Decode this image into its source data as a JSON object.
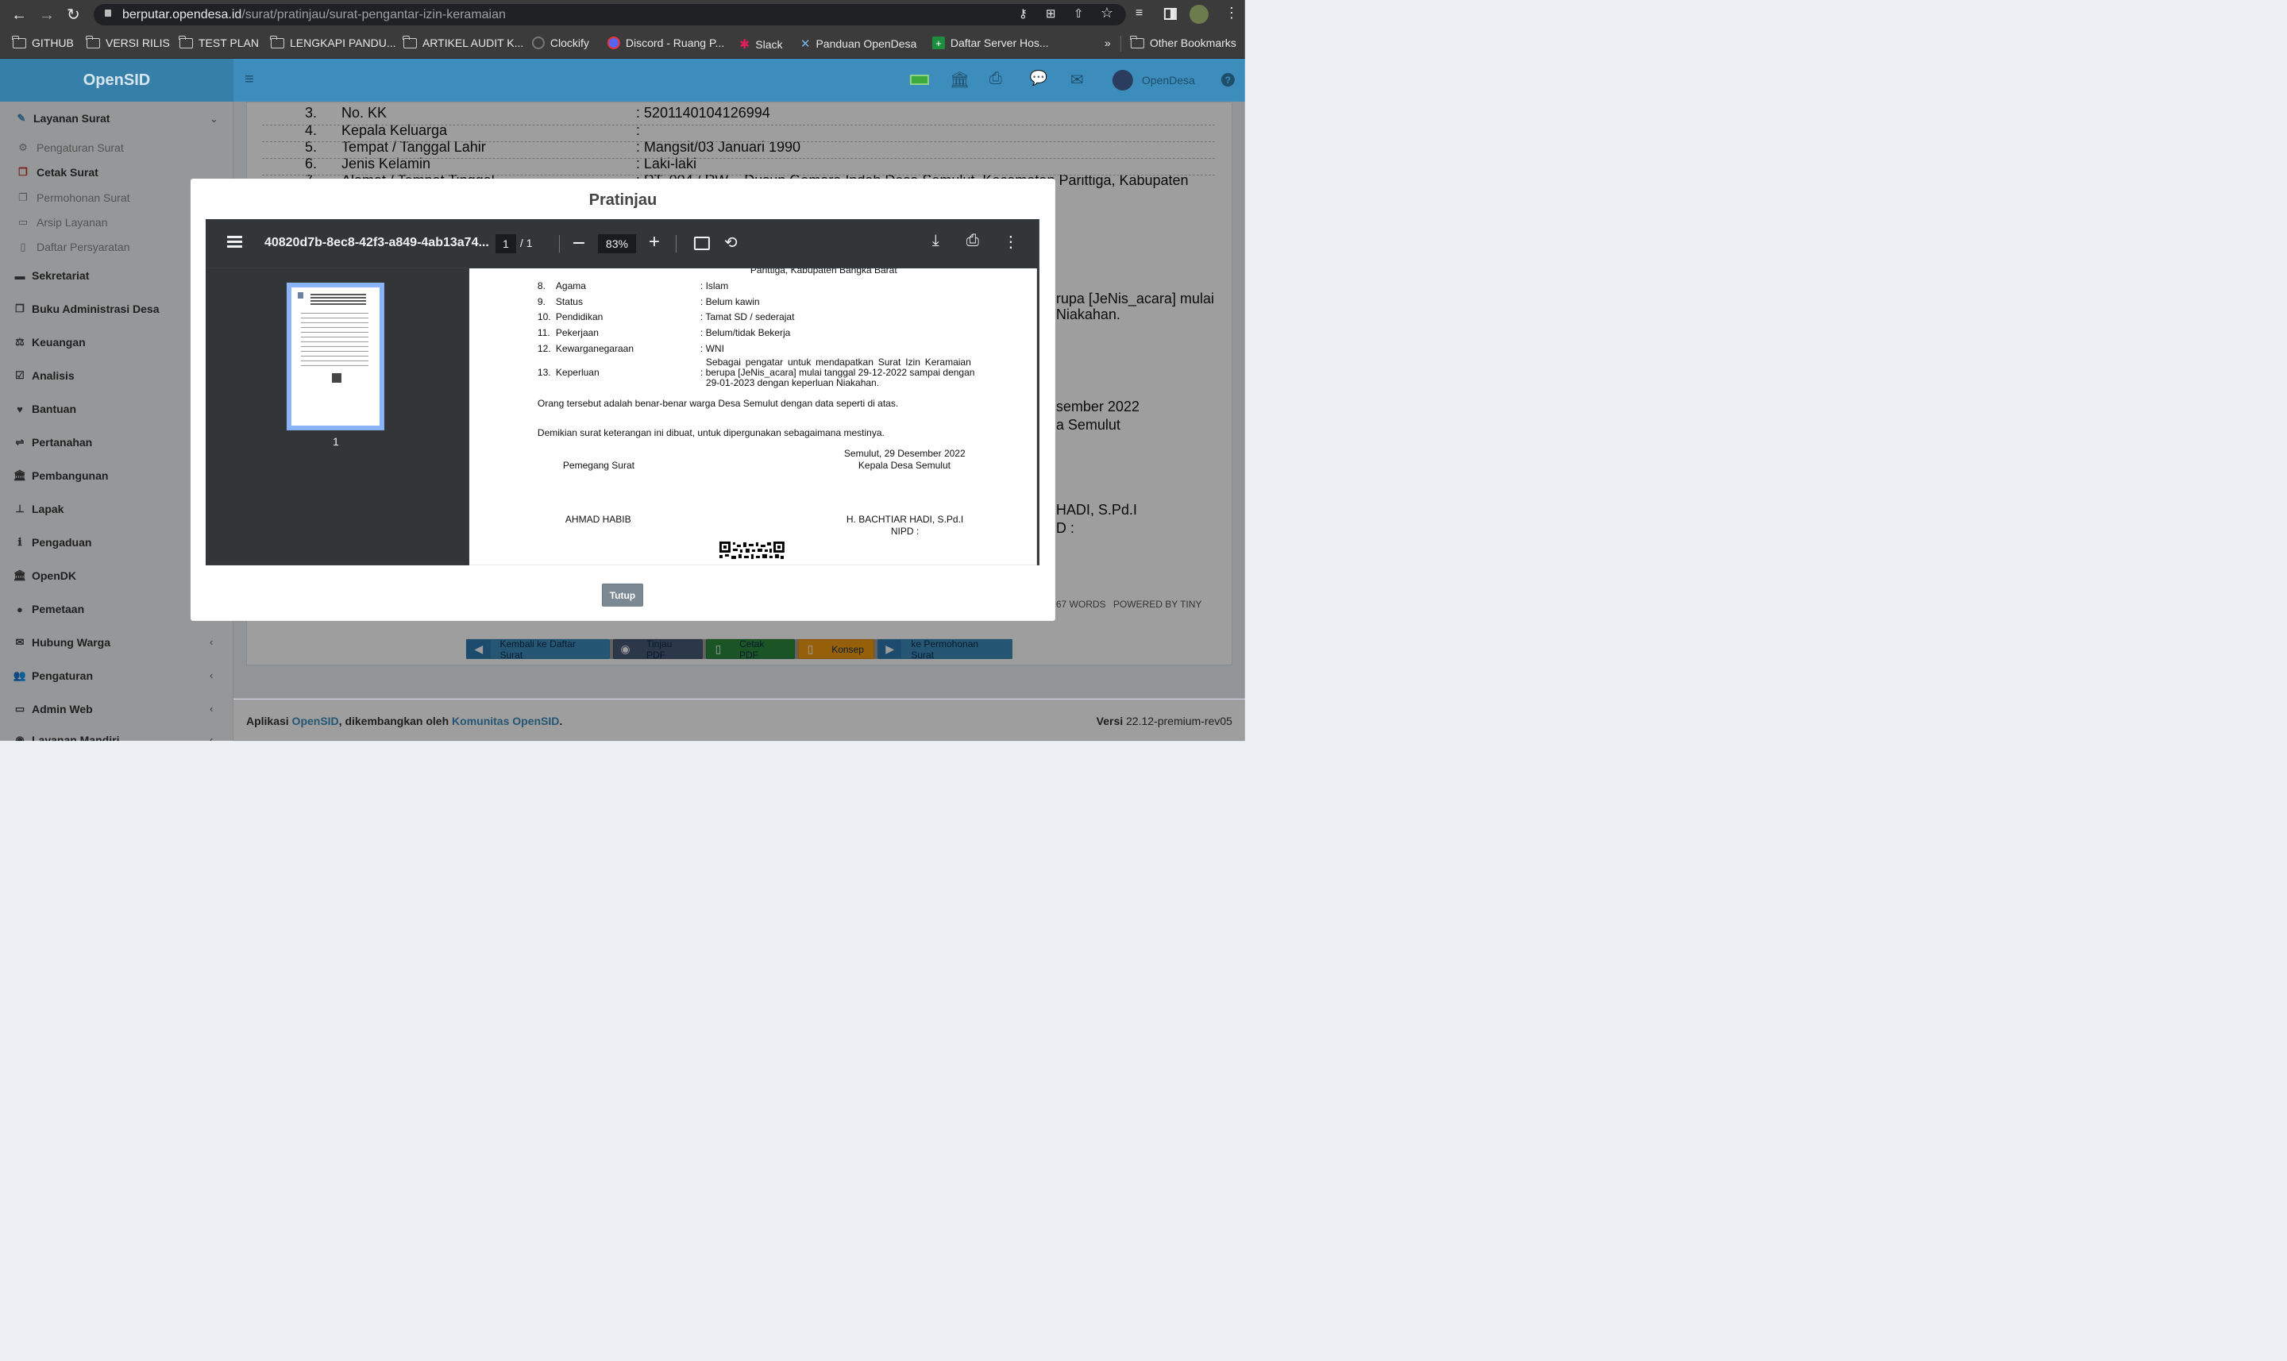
{
  "browser": {
    "url_host": "berputar.opendesa.id",
    "url_path": "/surat/pratinjau/surat-pengantar-izin-keramaian",
    "bookmarks": [
      "GITHUB",
      "VERSI RILIS",
      "TEST PLAN",
      "LENGKAPI PANDU...",
      "ARTIKEL AUDIT K...",
      "Clockify",
      "Discord - Ruang P...",
      "Slack",
      "Panduan OpenDesa",
      "Daftar Server Hos..."
    ],
    "more": "»",
    "other_bookmarks": "Other Bookmarks"
  },
  "app": {
    "logo": "OpenSID",
    "user": "OpenDesa"
  },
  "sidebar": {
    "group": "Layanan Surat",
    "sub": [
      "Pengaturan Surat",
      "Cetak Surat",
      "Permohonan Surat",
      "Arsip Layanan",
      "Daftar Persyaratan"
    ],
    "items": [
      "Sekretariat",
      "Buku Administrasi Desa",
      "Keuangan",
      "Analisis",
      "Bantuan",
      "Pertanahan",
      "Pembangunan",
      "Lapak",
      "Pengaduan",
      "OpenDK",
      "Pemetaan",
      "Hubung Warga",
      "Pengaturan",
      "Admin Web",
      "Layanan Mandiri"
    ]
  },
  "background": {
    "rows": [
      {
        "no": "3.",
        "label": "No. KK",
        "value": ": 5201140104126994"
      },
      {
        "no": "4.",
        "label": "Kepala Keluarga",
        "value": ":"
      },
      {
        "no": "5.",
        "label": "Tempat / Tanggal Lahir",
        "value": ": Mangsit/03 Januari 1990"
      },
      {
        "no": "6.",
        "label": "Jenis Kelamin",
        "value": ": Laki-laki"
      },
      {
        "no": "7.",
        "label": "Alamat / Tempat Tinggal",
        "value": ": RT. 004 / RW. - Dusun Gemara Indah Desa Semulut, Kecamatan Parittiga, Kabupaten"
      }
    ],
    "right1": "rupa [JeNis_acara] mulai",
    "right2": "Niakahan.",
    "right3": "sember 2022",
    "right4": "a Semulut",
    "right5": "HADI, S.Pd.I",
    "right6": "D :",
    "words": "67 WORDS",
    "powered": "POWERED BY TINY"
  },
  "modal": {
    "title": "Pratinjau",
    "close": "Tutup",
    "pdf": {
      "filename": "40820d7b-8ec8-42f3-a849-4ab13a74...",
      "page": "1",
      "pages": "/ 1",
      "zoom": "83%",
      "thumb_label": "1",
      "top_text": "Parittiga, Kabupaten Bangka Barat",
      "rows": [
        {
          "no": "8.",
          "label": "Agama",
          "value": ": Islam"
        },
        {
          "no": "9.",
          "label": "Status",
          "value": ": Belum kawin"
        },
        {
          "no": "10.",
          "label": "Pendidikan",
          "value": ": Tamat SD / sederajat"
        },
        {
          "no": "11.",
          "label": "Pekerjaan",
          "value": ": Belum/tidak Bekerja"
        },
        {
          "no": "12.",
          "label": "Kewarganegaraan",
          "value": ": WNI"
        }
      ],
      "row13_no": "13.",
      "row13_label": "Keperluan",
      "row13_l1": "Sebagai pengatar untuk mendapatkan Surat Izin Keramaian",
      "row13_l2": ": berupa [JeNis_acara] mulai tanggal 29-12-2022 sampai dengan",
      "row13_l3": "29-01-2023 dengan keperluan Niakahan.",
      "p1": "Orang tersebut adalah benar-benar warga Desa Semulut dengan data seperti di atas.",
      "p2": "Demikian surat keterangan ini dibuat, untuk dipergunakan sebagaimana mestinya.",
      "place_date": "Semulut, 29 Desember 2022",
      "holder": "Pemegang Surat",
      "official": "Kepala Desa Semulut",
      "holder_name": "AHMAD HABIB",
      "official_name": "H. BACHTIAR HADI, S.Pd.I",
      "nipd": "NIPD :"
    }
  },
  "actions": [
    "Kembali ke Daftar Surat",
    "Tinjau PDF",
    "Cetak PDF",
    "Konsep",
    "ke Permohonan Surat"
  ],
  "footer": {
    "pre": "Aplikasi ",
    "app": "OpenSID",
    "mid": ", dikembangkan oleh ",
    "community": "Komunitas OpenSID",
    "post": ".",
    "version_label": "Versi",
    "version": "22.12-premium-rev05"
  }
}
